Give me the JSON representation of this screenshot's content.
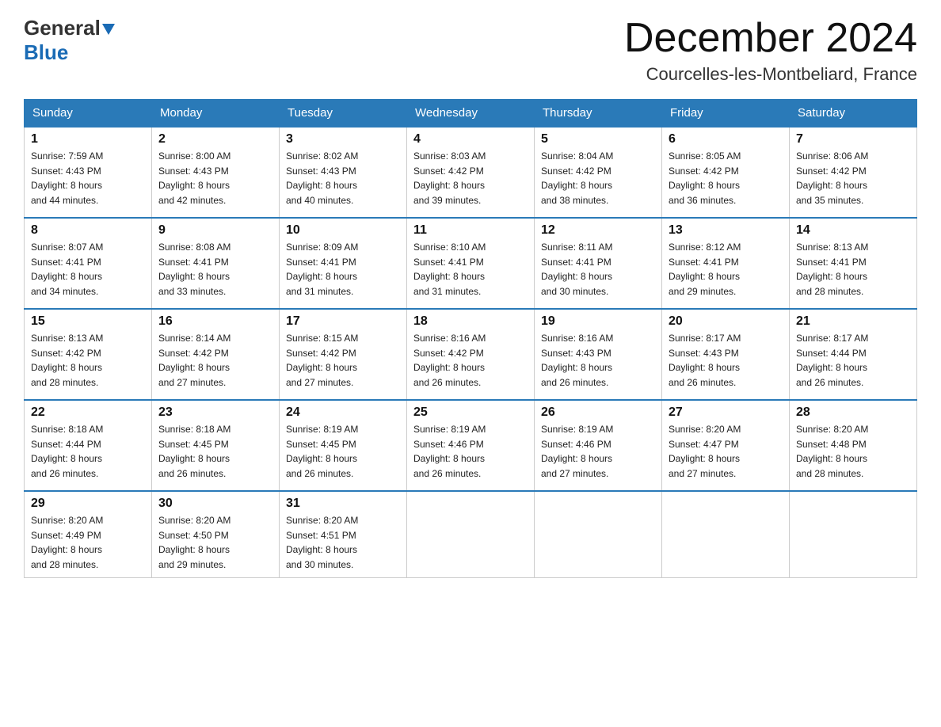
{
  "logo": {
    "line1_black": "General",
    "line1_triangle": true,
    "line2": "Blue"
  },
  "title": "December 2024",
  "location": "Courcelles-les-Montbeliard, France",
  "weekdays": [
    "Sunday",
    "Monday",
    "Tuesday",
    "Wednesday",
    "Thursday",
    "Friday",
    "Saturday"
  ],
  "weeks": [
    [
      {
        "day": "1",
        "info": "Sunrise: 7:59 AM\nSunset: 4:43 PM\nDaylight: 8 hours\nand 44 minutes."
      },
      {
        "day": "2",
        "info": "Sunrise: 8:00 AM\nSunset: 4:43 PM\nDaylight: 8 hours\nand 42 minutes."
      },
      {
        "day": "3",
        "info": "Sunrise: 8:02 AM\nSunset: 4:43 PM\nDaylight: 8 hours\nand 40 minutes."
      },
      {
        "day": "4",
        "info": "Sunrise: 8:03 AM\nSunset: 4:42 PM\nDaylight: 8 hours\nand 39 minutes."
      },
      {
        "day": "5",
        "info": "Sunrise: 8:04 AM\nSunset: 4:42 PM\nDaylight: 8 hours\nand 38 minutes."
      },
      {
        "day": "6",
        "info": "Sunrise: 8:05 AM\nSunset: 4:42 PM\nDaylight: 8 hours\nand 36 minutes."
      },
      {
        "day": "7",
        "info": "Sunrise: 8:06 AM\nSunset: 4:42 PM\nDaylight: 8 hours\nand 35 minutes."
      }
    ],
    [
      {
        "day": "8",
        "info": "Sunrise: 8:07 AM\nSunset: 4:41 PM\nDaylight: 8 hours\nand 34 minutes."
      },
      {
        "day": "9",
        "info": "Sunrise: 8:08 AM\nSunset: 4:41 PM\nDaylight: 8 hours\nand 33 minutes."
      },
      {
        "day": "10",
        "info": "Sunrise: 8:09 AM\nSunset: 4:41 PM\nDaylight: 8 hours\nand 31 minutes."
      },
      {
        "day": "11",
        "info": "Sunrise: 8:10 AM\nSunset: 4:41 PM\nDaylight: 8 hours\nand 31 minutes."
      },
      {
        "day": "12",
        "info": "Sunrise: 8:11 AM\nSunset: 4:41 PM\nDaylight: 8 hours\nand 30 minutes."
      },
      {
        "day": "13",
        "info": "Sunrise: 8:12 AM\nSunset: 4:41 PM\nDaylight: 8 hours\nand 29 minutes."
      },
      {
        "day": "14",
        "info": "Sunrise: 8:13 AM\nSunset: 4:41 PM\nDaylight: 8 hours\nand 28 minutes."
      }
    ],
    [
      {
        "day": "15",
        "info": "Sunrise: 8:13 AM\nSunset: 4:42 PM\nDaylight: 8 hours\nand 28 minutes."
      },
      {
        "day": "16",
        "info": "Sunrise: 8:14 AM\nSunset: 4:42 PM\nDaylight: 8 hours\nand 27 minutes."
      },
      {
        "day": "17",
        "info": "Sunrise: 8:15 AM\nSunset: 4:42 PM\nDaylight: 8 hours\nand 27 minutes."
      },
      {
        "day": "18",
        "info": "Sunrise: 8:16 AM\nSunset: 4:42 PM\nDaylight: 8 hours\nand 26 minutes."
      },
      {
        "day": "19",
        "info": "Sunrise: 8:16 AM\nSunset: 4:43 PM\nDaylight: 8 hours\nand 26 minutes."
      },
      {
        "day": "20",
        "info": "Sunrise: 8:17 AM\nSunset: 4:43 PM\nDaylight: 8 hours\nand 26 minutes."
      },
      {
        "day": "21",
        "info": "Sunrise: 8:17 AM\nSunset: 4:44 PM\nDaylight: 8 hours\nand 26 minutes."
      }
    ],
    [
      {
        "day": "22",
        "info": "Sunrise: 8:18 AM\nSunset: 4:44 PM\nDaylight: 8 hours\nand 26 minutes."
      },
      {
        "day": "23",
        "info": "Sunrise: 8:18 AM\nSunset: 4:45 PM\nDaylight: 8 hours\nand 26 minutes."
      },
      {
        "day": "24",
        "info": "Sunrise: 8:19 AM\nSunset: 4:45 PM\nDaylight: 8 hours\nand 26 minutes."
      },
      {
        "day": "25",
        "info": "Sunrise: 8:19 AM\nSunset: 4:46 PM\nDaylight: 8 hours\nand 26 minutes."
      },
      {
        "day": "26",
        "info": "Sunrise: 8:19 AM\nSunset: 4:46 PM\nDaylight: 8 hours\nand 27 minutes."
      },
      {
        "day": "27",
        "info": "Sunrise: 8:20 AM\nSunset: 4:47 PM\nDaylight: 8 hours\nand 27 minutes."
      },
      {
        "day": "28",
        "info": "Sunrise: 8:20 AM\nSunset: 4:48 PM\nDaylight: 8 hours\nand 28 minutes."
      }
    ],
    [
      {
        "day": "29",
        "info": "Sunrise: 8:20 AM\nSunset: 4:49 PM\nDaylight: 8 hours\nand 28 minutes."
      },
      {
        "day": "30",
        "info": "Sunrise: 8:20 AM\nSunset: 4:50 PM\nDaylight: 8 hours\nand 29 minutes."
      },
      {
        "day": "31",
        "info": "Sunrise: 8:20 AM\nSunset: 4:51 PM\nDaylight: 8 hours\nand 30 minutes."
      },
      null,
      null,
      null,
      null
    ]
  ]
}
